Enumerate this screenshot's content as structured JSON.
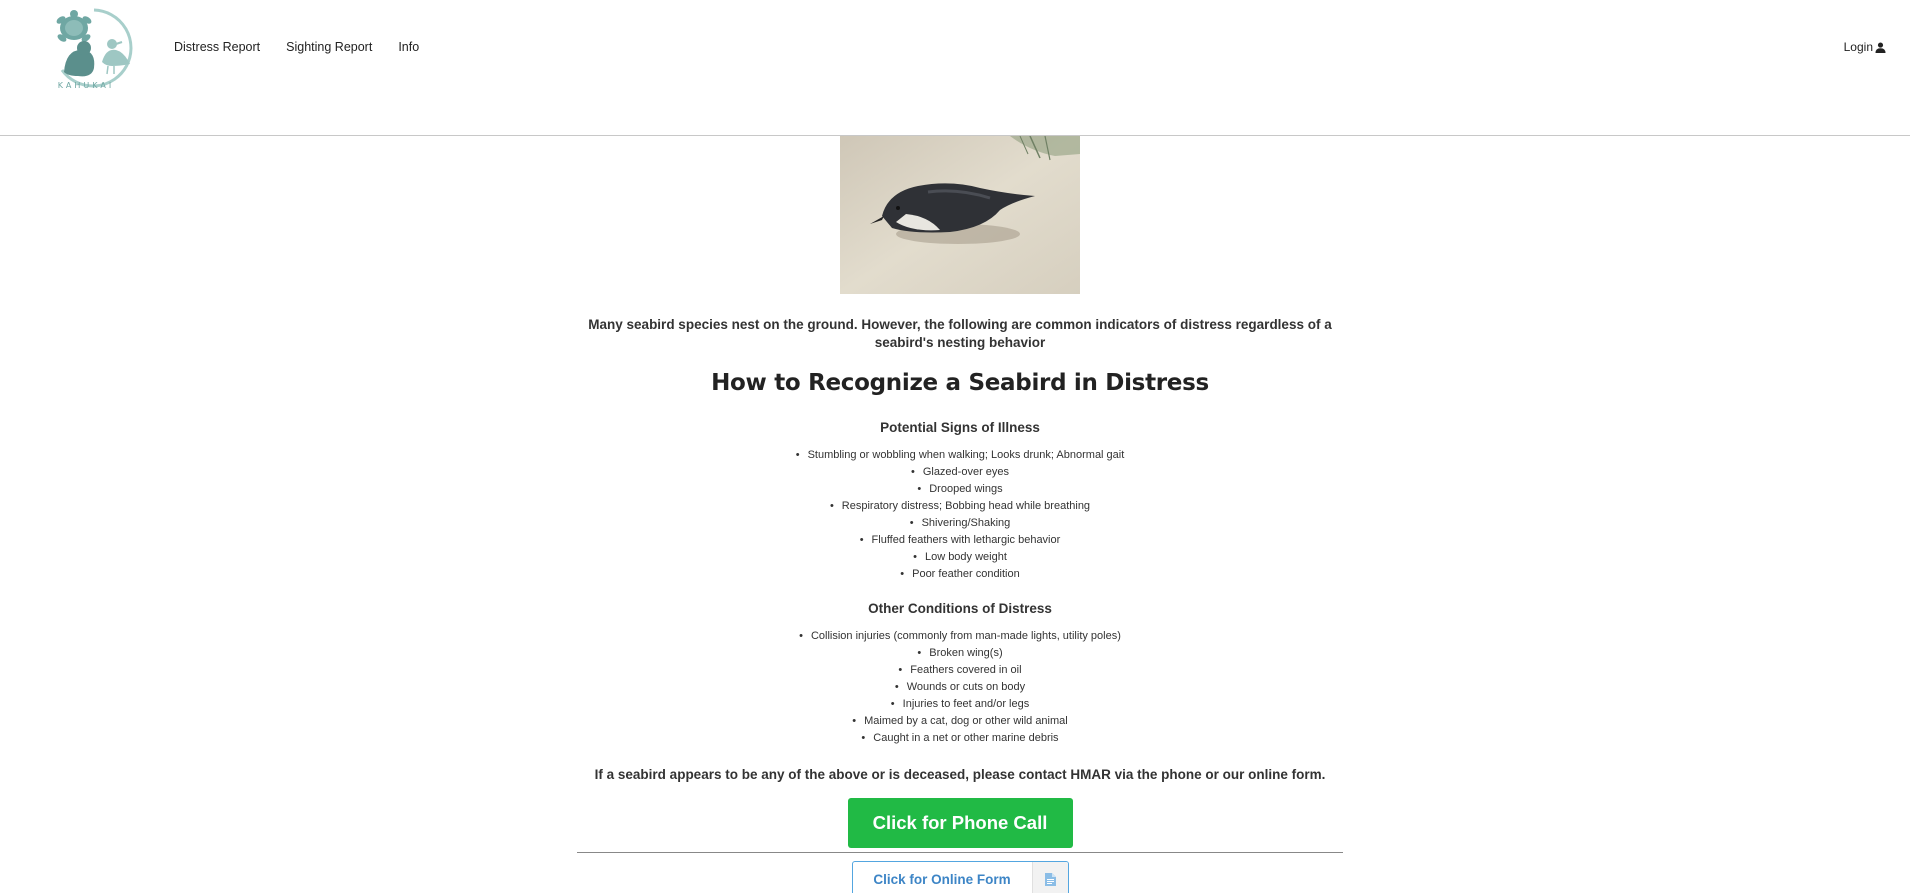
{
  "header": {
    "logo_text": "KAHUKAI",
    "nav": [
      {
        "label": "Distress Report"
      },
      {
        "label": "Sighting Report"
      },
      {
        "label": "Info"
      }
    ],
    "login_label": "Login"
  },
  "main": {
    "intro": "Many seabird species nest on the ground. However, the following are common indicators of distress regardless of a seabird's nesting behavior",
    "title": "How to Recognize a Seabird in Distress",
    "illness_heading": "Potential Signs of Illness",
    "illness_items": [
      "Stumbling or wobbling when walking; Looks drunk; Abnormal gait",
      "Glazed-over eyes",
      "Drooped wings",
      "Respiratory distress; Bobbing head while breathing",
      "Shivering/Shaking",
      "Fluffed feathers with lethargic behavior",
      "Low body weight",
      "Poor feather condition"
    ],
    "other_heading": "Other Conditions of Distress",
    "other_items": [
      "Collision injuries (commonly from man-made lights, utility poles)",
      "Broken wing(s)",
      "Feathers covered in oil",
      "Wounds or cuts on body",
      "Injuries to feet and/or legs",
      "Maimed by a cat, dog or other wild animal",
      "Caught in a net or other marine debris"
    ],
    "contact_text": "If a seabird appears to be any of the above or is deceased, please contact HMAR via the phone or our online form.",
    "phone_button": "Click for Phone Call",
    "form_button": "Click for Online Form"
  },
  "colors": {
    "phone_button_bg": "#21ba45",
    "form_button_border": "#54a6e0",
    "form_button_text": "#3d85c6",
    "logo_teal": "#6fa7a3"
  },
  "icons": {
    "login": "user-icon",
    "form": "file-text-icon"
  }
}
